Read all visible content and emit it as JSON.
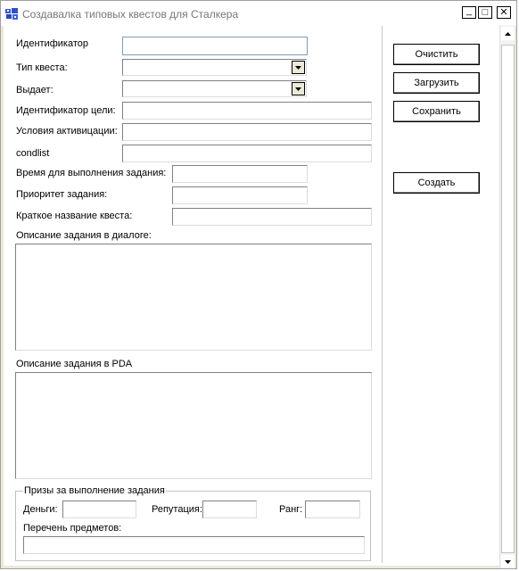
{
  "window": {
    "title": "Создавалка типовых квестов для Сталкера",
    "minimize": "_",
    "maximize": "□",
    "close": "✕"
  },
  "form": {
    "identifier_label": "Идентификатор",
    "identifier_value": "",
    "quest_type_label": "Тип квеста:",
    "quest_type_value": "",
    "issuer_label": "Выдает:",
    "issuer_value": "",
    "target_id_label": "Идентификатор цели:",
    "target_id_value": "",
    "activation_label": "Условия активицации:",
    "activation_value": "",
    "condlist_label": "condlist",
    "condlist_value": "",
    "time_label": "Время для выполнения задания:",
    "time_value": "",
    "priority_label": "Приоритет задания:",
    "priority_value": "",
    "short_name_label": "Краткое название квеста:",
    "short_name_value": "",
    "dialog_desc_label": "Описание задания в диалоге:",
    "dialog_desc_value": "",
    "pda_desc_label": "Описание задания в PDA",
    "pda_desc_value": ""
  },
  "rewards": {
    "group_label": "Призы за выполнение задания",
    "money_label": "Деньги:",
    "money_value": "",
    "reputation_label": "Репутация:",
    "reputation_value": "",
    "rank_label": "Ранг:",
    "rank_value": "",
    "items_label": "Перечень предметов:",
    "items_value": ""
  },
  "buttons": {
    "clear": "Очистить",
    "load": "Загрузить",
    "save": "Сохранить",
    "create": "Создать"
  },
  "icons": {
    "app": "app-icon",
    "combo": "chevron-down-icon",
    "scroll_up": "arrow-up-icon",
    "scroll_down": "arrow-down-icon"
  }
}
